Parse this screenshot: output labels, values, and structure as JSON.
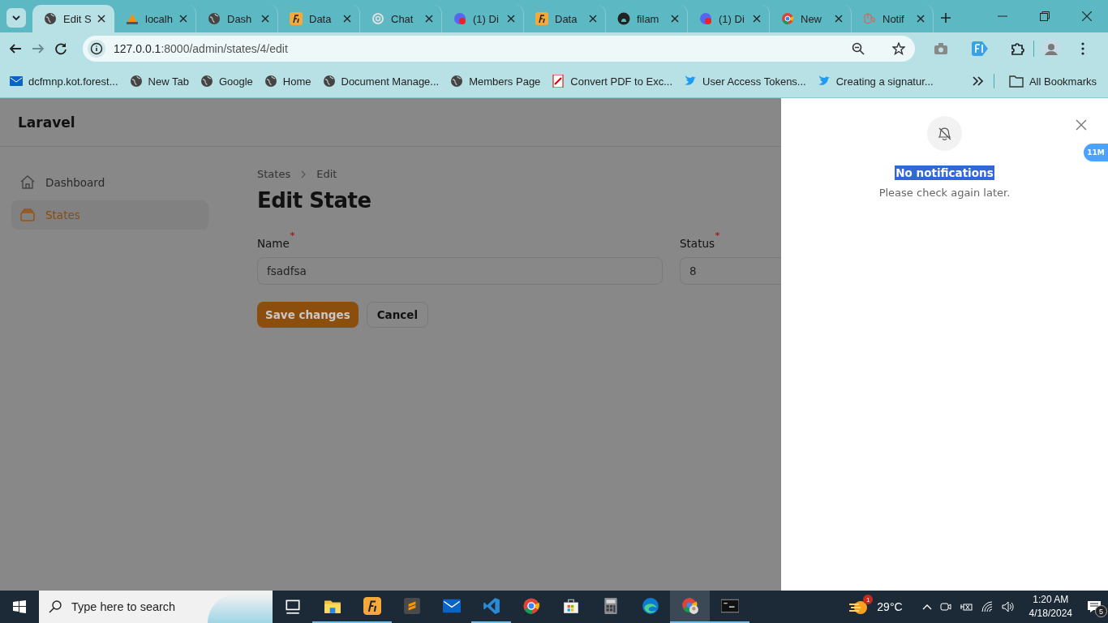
{
  "browser": {
    "tabs": [
      {
        "title": "Edit S",
        "kind": "globe",
        "selected": true
      },
      {
        "title": "localh",
        "kind": "sail",
        "selected": false
      },
      {
        "title": "Dash",
        "kind": "globe",
        "selected": false
      },
      {
        "title": "Data",
        "kind": "orange",
        "selected": false
      },
      {
        "title": "Chat",
        "kind": "knot",
        "selected": false
      },
      {
        "title": "(1) Di",
        "kind": "bubble",
        "selected": false
      },
      {
        "title": "Data",
        "kind": "orange",
        "selected": false
      },
      {
        "title": "filam",
        "kind": "cat",
        "selected": false
      },
      {
        "title": "(1) Di",
        "kind": "bubble",
        "selected": false
      },
      {
        "title": "New",
        "kind": "ring",
        "selected": false
      },
      {
        "title": "Notif",
        "kind": "cube",
        "selected": false
      }
    ],
    "address": {
      "host": "127.0.0.1",
      "path": ":8000/admin/states/4/edit"
    },
    "bookmarks": [
      {
        "label": "dcfmnp.kot.forest...",
        "kind": "mail"
      },
      {
        "label": "New Tab",
        "kind": "globe"
      },
      {
        "label": "Google",
        "kind": "globe"
      },
      {
        "label": "Home",
        "kind": "globe"
      },
      {
        "label": "Document Manage...",
        "kind": "globe"
      },
      {
        "label": "Members Page",
        "kind": "globe"
      },
      {
        "label": "Convert PDF to Exc...",
        "kind": "doc"
      },
      {
        "label": "User Access Tokens...",
        "kind": "bird"
      },
      {
        "label": "Creating a signatur...",
        "kind": "bird"
      }
    ],
    "all_bookmarks": "All Bookmarks"
  },
  "app": {
    "brand": "Laravel",
    "sidebar": [
      {
        "label": "Dashboard",
        "kind": "home",
        "selected": false
      },
      {
        "label": "States",
        "kind": "stack",
        "selected": true
      }
    ],
    "breadcrumbs": [
      "States",
      "Edit"
    ],
    "heading": "Edit State",
    "fields": [
      {
        "label": "Name",
        "required": true,
        "value": "fsadfsa"
      },
      {
        "label": "Status",
        "required": true,
        "value": "8"
      }
    ],
    "buttons": [
      {
        "label": "Save changes",
        "kind": "primary"
      },
      {
        "label": "Cancel",
        "kind": "secondary"
      }
    ]
  },
  "notifications": {
    "title": "No notifications",
    "message": "Please check again later.",
    "badge": "11M"
  },
  "taskbar": {
    "search_placeholder": "Type here to search",
    "apps": [
      {
        "kind": "taskview",
        "running": false,
        "selected": false
      },
      {
        "kind": "folder",
        "running": true,
        "selected": false
      },
      {
        "kind": "orange",
        "running": true,
        "selected": false
      },
      {
        "kind": "editor",
        "running": false,
        "selected": false
      },
      {
        "kind": "mail",
        "running": false,
        "selected": false
      },
      {
        "kind": "code",
        "running": true,
        "selected": false
      },
      {
        "kind": "ring",
        "running": false,
        "selected": false
      },
      {
        "kind": "bag",
        "running": false,
        "selected": false
      },
      {
        "kind": "calc",
        "running": false,
        "selected": false
      },
      {
        "kind": "wave",
        "running": false,
        "selected": false
      },
      {
        "kind": "ringperson",
        "running": true,
        "selected": true
      },
      {
        "kind": "terminal",
        "running": true,
        "selected": false
      }
    ],
    "weather_badge": "1",
    "temperature": "29°C",
    "time": "1:20 AM",
    "date": "4/18/2024",
    "notification_count": "5"
  }
}
